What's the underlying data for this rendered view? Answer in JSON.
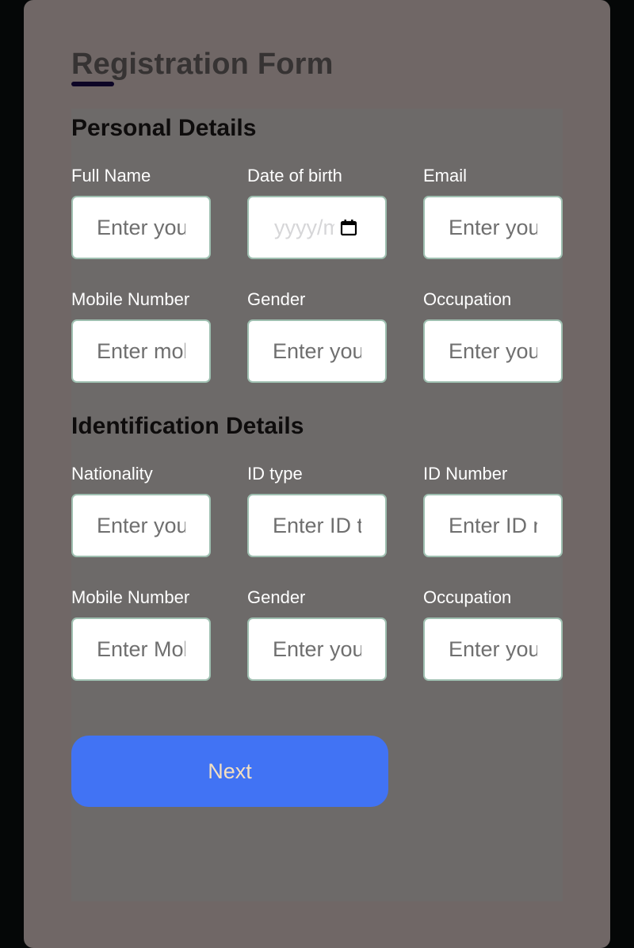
{
  "form": {
    "title": "Registration Form",
    "sections": [
      {
        "title": "Personal Details",
        "fields": [
          {
            "label": "Full Name",
            "placeholder": "Enter your name",
            "type": "text"
          },
          {
            "label": "Date of birth",
            "placeholder": "yyyy/mm/dd",
            "type": "date"
          },
          {
            "label": "Email",
            "placeholder": "Enter your email",
            "type": "text"
          },
          {
            "label": "Mobile Number",
            "placeholder": "Enter mobile number",
            "type": "text"
          },
          {
            "label": "Gender",
            "placeholder": "Enter your gender",
            "type": "text"
          },
          {
            "label": "Occupation",
            "placeholder": "Enter your occupation",
            "type": "text"
          }
        ]
      },
      {
        "title": "Identification Details",
        "fields": [
          {
            "label": "Nationality",
            "placeholder": "Enter your nationality",
            "type": "text"
          },
          {
            "label": "ID type",
            "placeholder": "Enter ID type",
            "type": "text"
          },
          {
            "label": "ID Number",
            "placeholder": "Enter ID number",
            "type": "text"
          },
          {
            "label": "Mobile Number",
            "placeholder": "Enter Mobile number",
            "type": "text"
          },
          {
            "label": "Gender",
            "placeholder": "Enter your gender",
            "type": "text"
          },
          {
            "label": "Occupation",
            "placeholder": "Enter your occupation",
            "type": "text"
          }
        ]
      }
    ],
    "next_label": "Next",
    "colors": {
      "accent": "#4173f4",
      "button_text": "#f3dfc1",
      "input_border": "#9ebfb0",
      "title_underline": "#0d0526"
    }
  }
}
